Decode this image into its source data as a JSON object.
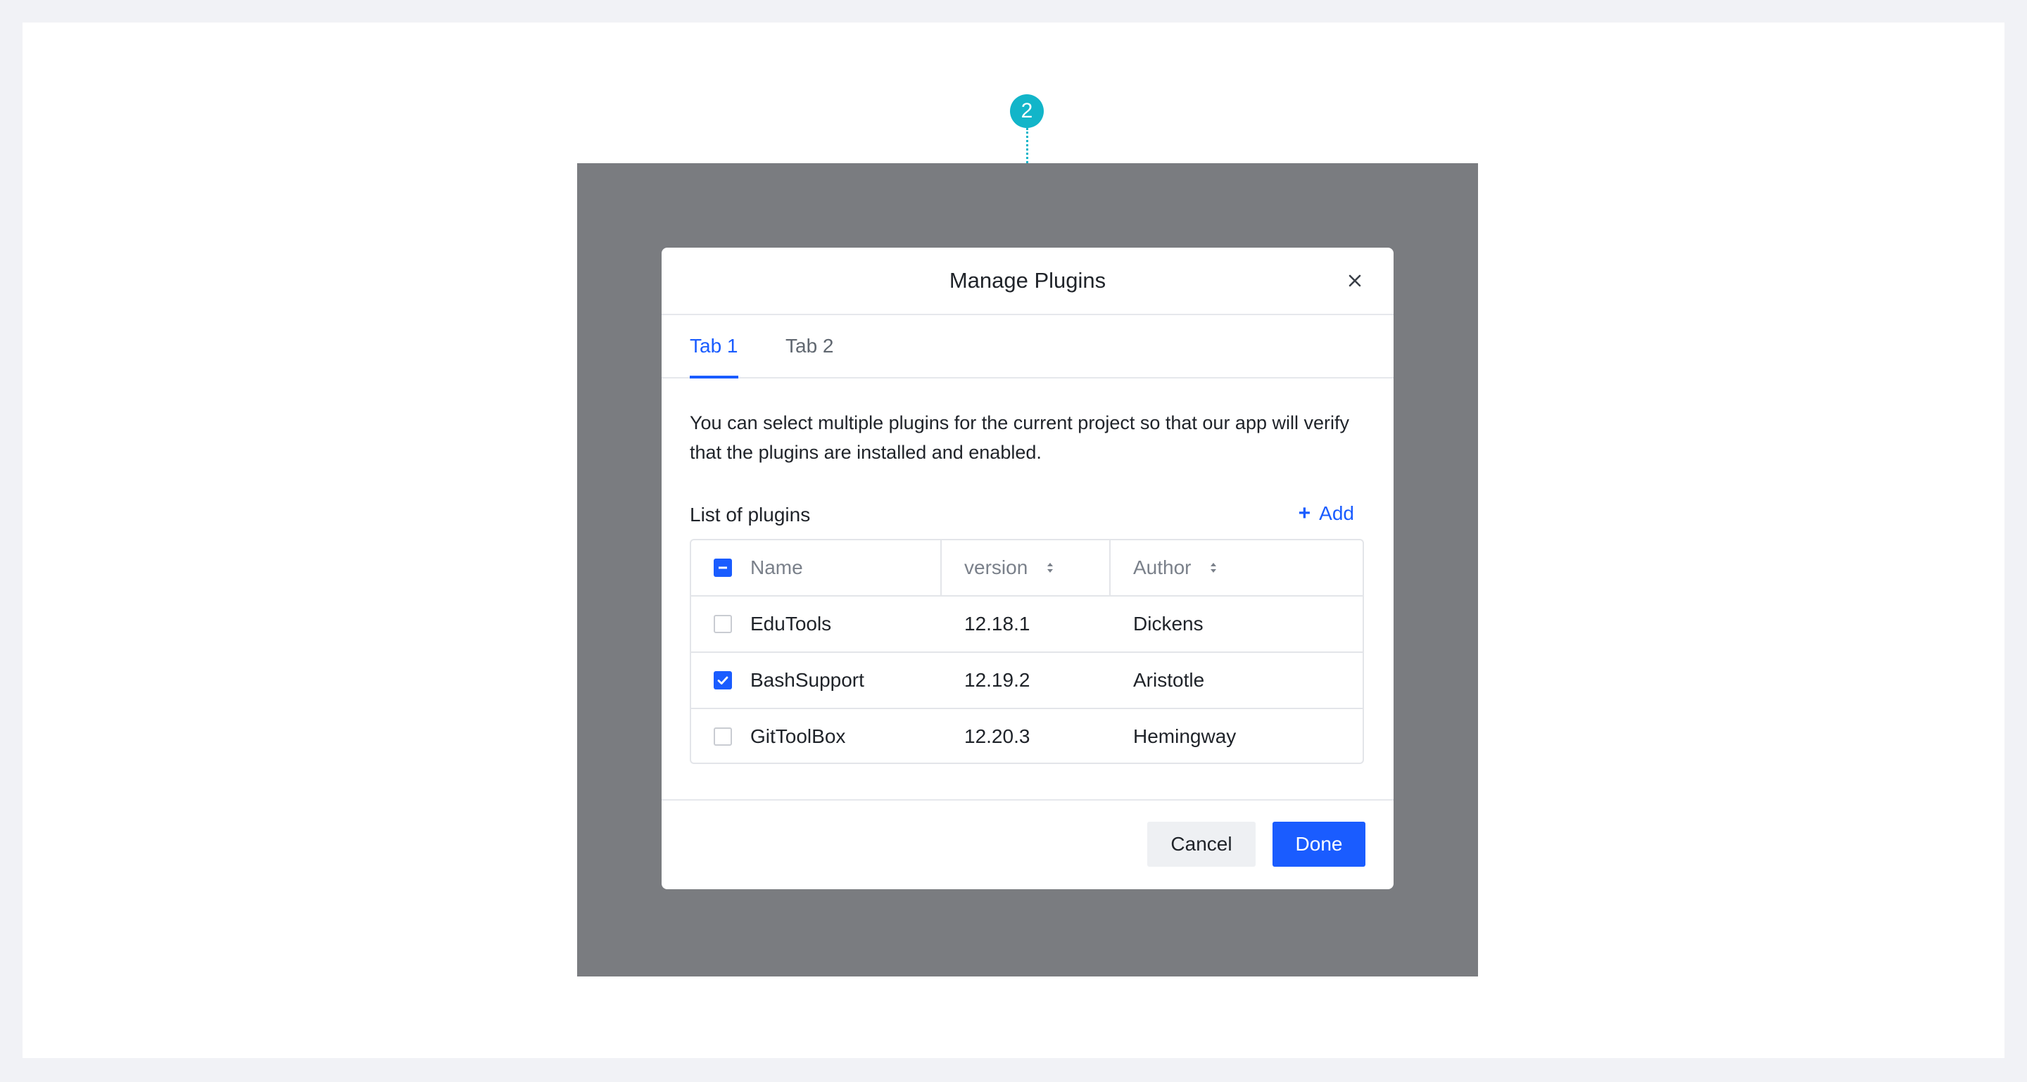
{
  "step_marker": {
    "number": "2",
    "color": "#12b5c9"
  },
  "colors": {
    "accent": "#1a5cff",
    "overlay": "#7a7c80"
  },
  "dialog": {
    "title": "Manage Plugins",
    "close_icon": "close-icon",
    "tabs": [
      {
        "label": "Tab 1",
        "active": true
      },
      {
        "label": "Tab 2",
        "active": false
      }
    ],
    "description": "You can select multiple plugins for the current project so that our app will verify that the plugins are installed and enabled.",
    "list_label": "List of plugins",
    "add_label": "Add",
    "table": {
      "header_checkbox_state": "indeterminate",
      "columns": [
        {
          "label": "Name",
          "sortable": false
        },
        {
          "label": "version",
          "sortable": true
        },
        {
          "label": "Author",
          "sortable": true
        }
      ],
      "rows": [
        {
          "name": "EduTools",
          "version": "12.18.1",
          "author": "Dickens",
          "checked": false
        },
        {
          "name": "BashSupport",
          "version": "12.19.2",
          "author": "Aristotle",
          "checked": true
        },
        {
          "name": "GitToolBox",
          "version": "12.20.3",
          "author": "Hemingway",
          "checked": false
        }
      ]
    },
    "footer": {
      "cancel_label": "Cancel",
      "done_label": "Done"
    }
  }
}
